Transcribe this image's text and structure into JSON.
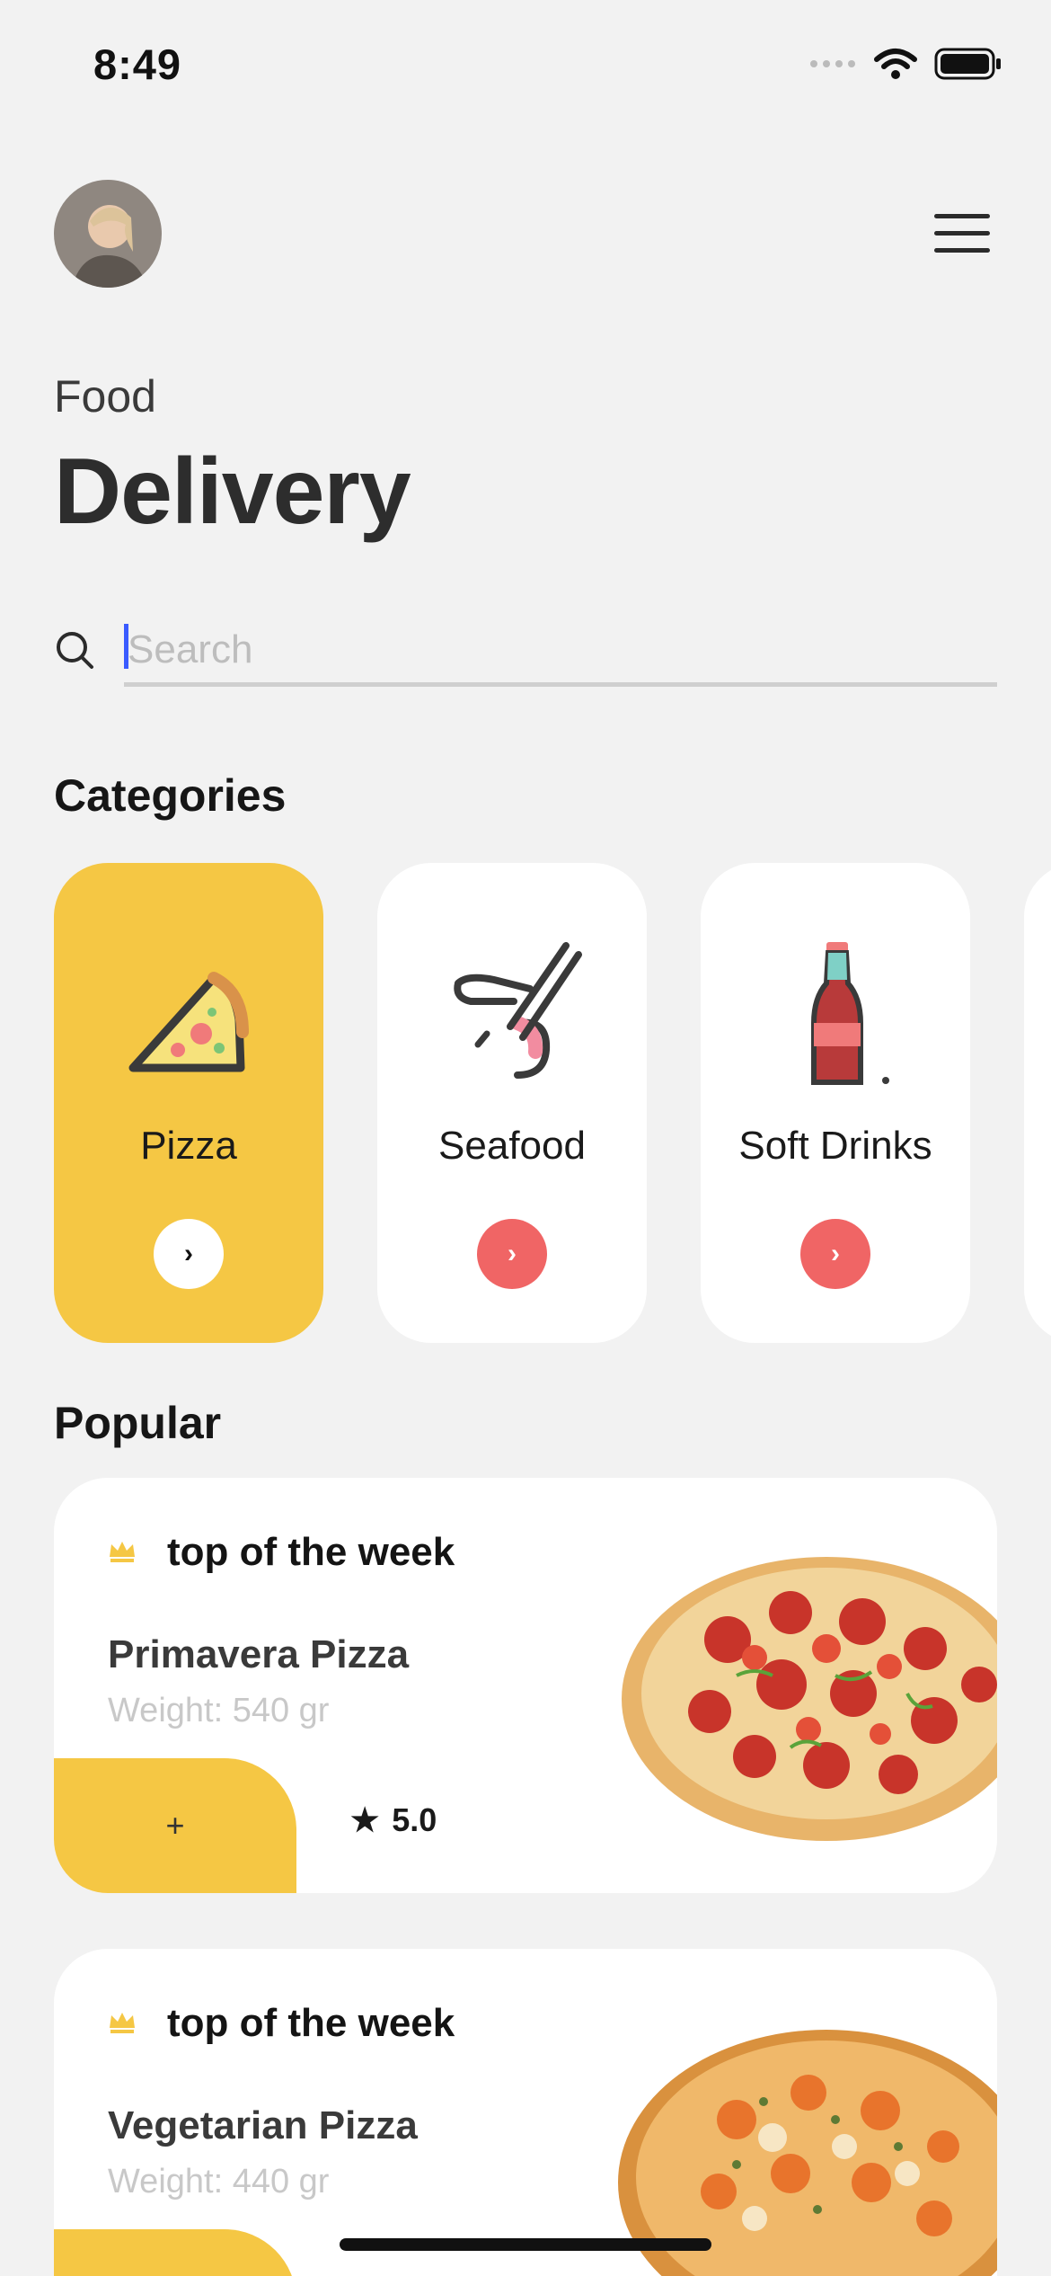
{
  "status_bar": {
    "time": "8:49"
  },
  "header": {
    "subtitle": "Food",
    "title": "Delivery"
  },
  "search": {
    "placeholder": "Search"
  },
  "categories": {
    "heading": "Categories",
    "items": [
      {
        "label": "Pizza",
        "icon": "pizza-icon",
        "active": true
      },
      {
        "label": "Seafood",
        "icon": "shrimp-icon",
        "active": false
      },
      {
        "label": "Soft Drinks",
        "icon": "soda-bottle-icon",
        "active": false
      }
    ]
  },
  "popular": {
    "heading": "Popular",
    "items": [
      {
        "tag": "top of the week",
        "name": "Primavera Pizza",
        "weight": "Weight: 540 gr",
        "add_label": "+",
        "rating": "5.0"
      },
      {
        "tag": "top of the week",
        "name": "Vegetarian Pizza",
        "weight": "Weight: 440 gr",
        "add_label": "+",
        "rating": ""
      }
    ]
  },
  "colors": {
    "accent": "#f5c744",
    "arrow": "#f06565",
    "background": "#f2f2f2"
  }
}
